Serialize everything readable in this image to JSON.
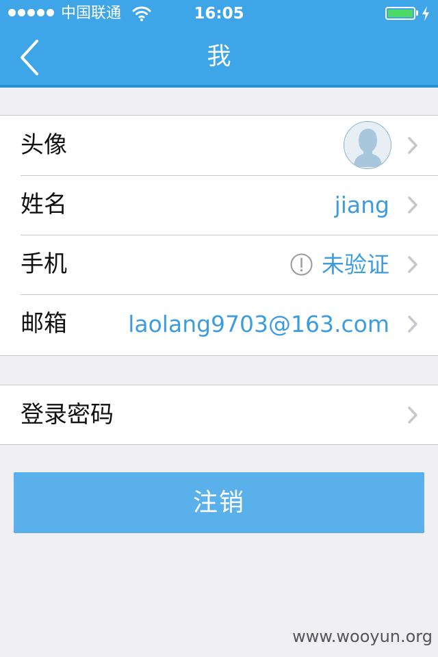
{
  "status_bar": {
    "carrier": "中国联通",
    "time": "16:05",
    "signal_icon": "signal-dots-icon",
    "wifi_icon": "wifi-icon",
    "battery_icon": "battery-icon",
    "charging_icon": "charging-bolt-icon",
    "battery_color": "#4cd964"
  },
  "nav": {
    "title": "我",
    "back_icon": "back-chevron-icon",
    "bar_color": "#3ea6e8"
  },
  "profile_rows": [
    {
      "label": "头像",
      "value": "",
      "icon": "avatar-placeholder-icon"
    },
    {
      "label": "姓名",
      "value": "jiang"
    },
    {
      "label": "手机",
      "value": "未验证",
      "icon": "exclamation-circle-icon"
    },
    {
      "label": "邮箱",
      "value": "laolang9703@163.com"
    }
  ],
  "security_rows": [
    {
      "label": "登录密码"
    }
  ],
  "logout": {
    "label": "注销",
    "color": "#5ab0ea"
  },
  "watermark": "www.wooyun.org",
  "accent_color": "#3d9ce0"
}
